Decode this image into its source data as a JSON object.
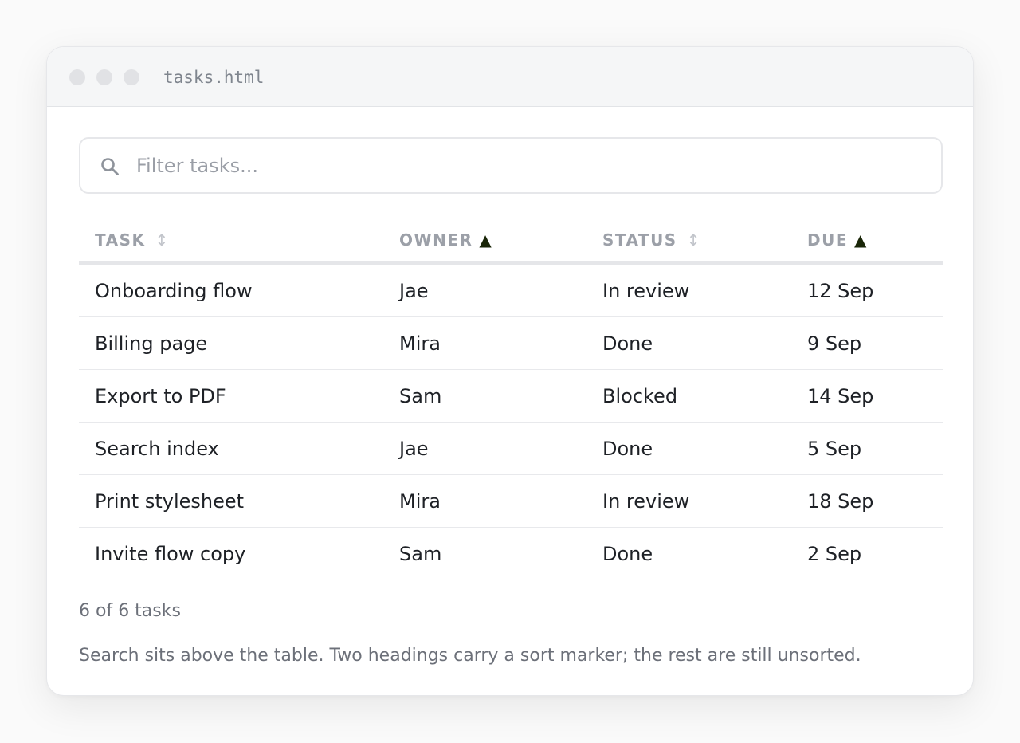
{
  "window": {
    "filename": "tasks.html"
  },
  "search": {
    "placeholder": "Filter tasks...",
    "value": "",
    "icon": "search-icon"
  },
  "table": {
    "columns": [
      {
        "label": "TASK",
        "sort": "unsorted",
        "sort_glyph": "↕"
      },
      {
        "label": "OWNER",
        "sort": "ascending",
        "sort_glyph": "▲"
      },
      {
        "label": "STATUS",
        "sort": "unsorted",
        "sort_glyph": "↕"
      },
      {
        "label": "DUE",
        "sort": "ascending",
        "sort_glyph": "▲"
      }
    ],
    "rows": [
      {
        "task": "Onboarding flow",
        "owner": "Jae",
        "status": "In review",
        "due": "12 Sep"
      },
      {
        "task": "Billing page",
        "owner": "Mira",
        "status": "Done",
        "due": "9 Sep"
      },
      {
        "task": "Export to PDF",
        "owner": "Sam",
        "status": "Blocked",
        "due": "14 Sep"
      },
      {
        "task": "Search index",
        "owner": "Jae",
        "status": "Done",
        "due": "5 Sep"
      },
      {
        "task": "Print stylesheet",
        "owner": "Mira",
        "status": "In review",
        "due": "18 Sep"
      },
      {
        "task": "Invite flow copy",
        "owner": "Sam",
        "status": "Done",
        "due": "2 Sep"
      }
    ]
  },
  "footer": {
    "count": "6 of 6 tasks",
    "note": "Search sits above the table. Two headings carry a sort marker; the rest are still unsorted."
  },
  "colors": {
    "sort_active": "#1a2608",
    "sort_inactive": "#c2c5cb",
    "header_text": "#9ca0a8"
  }
}
